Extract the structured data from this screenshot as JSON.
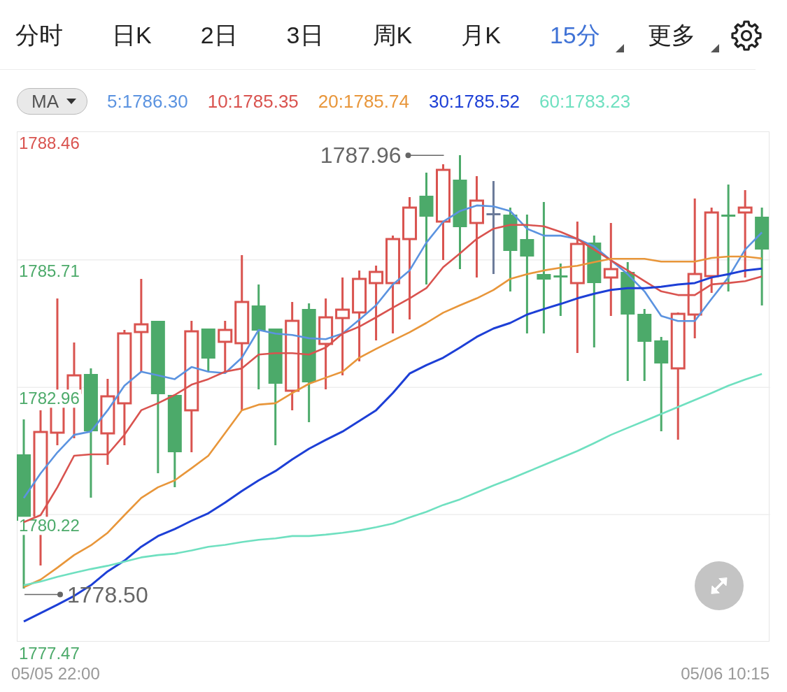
{
  "tabs": [
    {
      "label": "分时",
      "selected": false,
      "kind": "plain"
    },
    {
      "label": "日K",
      "selected": false,
      "kind": "plain"
    },
    {
      "label": "2日",
      "selected": false,
      "kind": "plain"
    },
    {
      "label": "3日",
      "selected": false,
      "kind": "plain"
    },
    {
      "label": "周K",
      "selected": false,
      "kind": "plain"
    },
    {
      "label": "月K",
      "selected": false,
      "kind": "plain"
    },
    {
      "label": "15分",
      "selected": true,
      "kind": "dropdown"
    },
    {
      "label": "更多",
      "selected": false,
      "kind": "dropdown"
    }
  ],
  "indicator": {
    "label": "MA",
    "readings": [
      {
        "text": "5:1786.30",
        "color": "#5b93e0"
      },
      {
        "text": "10:1785.35",
        "color": "#d9534f"
      },
      {
        "text": "20:1785.74",
        "color": "#e8963a"
      },
      {
        "text": "30:1785.52",
        "color": "#1d3fd6"
      },
      {
        "text": "60:1783.23",
        "color": "#6fe0c0"
      }
    ]
  },
  "chart": {
    "chart_data": {
      "type": "line",
      "grid": true,
      "ylim": [
        1777.47,
        1788.46
      ],
      "yticks": [
        {
          "value": 1788.46,
          "label": "1788.46"
        },
        {
          "value": 1785.71,
          "label": "1785.71"
        },
        {
          "value": 1782.96,
          "label": "1782.96"
        },
        {
          "value": 1780.22,
          "label": "1780.22"
        },
        {
          "value": 1777.47,
          "label": "1777.47"
        }
      ],
      "series": [
        {
          "color": "#5b93e0",
          "values": [
            1780.58,
            1781.11,
            1781.56,
            1781.94,
            1782.01,
            1782.47,
            1783.0,
            1783.3,
            1783.22,
            1783.14,
            1783.4,
            1783.3,
            1783.27,
            1783.6,
            1784.2,
            1784.12,
            1784.09,
            1784.02,
            1784.0,
            1784.12,
            1784.42,
            1784.73,
            1785.18,
            1785.48,
            1786.08,
            1786.53,
            1786.76,
            1786.88,
            1786.86,
            1786.76,
            1786.38,
            1786.23,
            1786.23,
            1786.16,
            1786.0,
            1785.7,
            1785.4,
            1785.03,
            1784.5,
            1784.39,
            1784.39,
            1784.87,
            1785.33,
            1785.93,
            1786.3
          ]
        },
        {
          "color": "#d9534f",
          "values": [
            1780.06,
            1780.21,
            1780.81,
            1781.49,
            1781.52,
            1781.52,
            1781.94,
            1782.47,
            1782.62,
            1782.8,
            1783.02,
            1783.14,
            1783.3,
            1783.37,
            1783.67,
            1783.7,
            1783.7,
            1783.67,
            1783.82,
            1784.12,
            1784.27,
            1784.47,
            1784.68,
            1784.88,
            1785.1,
            1785.55,
            1785.85,
            1786.16,
            1786.38,
            1786.46,
            1786.46,
            1786.43,
            1786.31,
            1786.16,
            1785.93,
            1785.7,
            1785.48,
            1785.25,
            1785.03,
            1784.95,
            1784.95,
            1785.18,
            1785.21,
            1785.25,
            1785.35
          ]
        },
        {
          "color": "#e8963a",
          "values": [
            1778.66,
            1778.82,
            1779.08,
            1779.35,
            1779.56,
            1779.83,
            1780.21,
            1780.58,
            1780.81,
            1780.96,
            1781.22,
            1781.49,
            1781.98,
            1782.47,
            1782.59,
            1782.62,
            1782.84,
            1783.04,
            1783.17,
            1783.3,
            1783.6,
            1783.79,
            1783.97,
            1784.15,
            1784.35,
            1784.57,
            1784.73,
            1784.88,
            1785.06,
            1785.3,
            1785.4,
            1785.48,
            1785.54,
            1785.58,
            1785.66,
            1785.73,
            1785.73,
            1785.73,
            1785.67,
            1785.67,
            1785.67,
            1785.75,
            1785.78,
            1785.78,
            1785.74
          ]
        },
        {
          "color": "#1d3fd6",
          "values": [
            1777.92,
            1778.1,
            1778.28,
            1778.47,
            1778.7,
            1779.0,
            1779.23,
            1779.53,
            1779.76,
            1779.91,
            1780.09,
            1780.25,
            1780.48,
            1780.73,
            1780.96,
            1781.16,
            1781.41,
            1781.64,
            1781.83,
            1782.01,
            1782.24,
            1782.47,
            1782.84,
            1783.26,
            1783.44,
            1783.6,
            1783.82,
            1784.05,
            1784.23,
            1784.35,
            1784.53,
            1784.65,
            1784.76,
            1784.88,
            1784.98,
            1785.06,
            1785.1,
            1785.1,
            1785.13,
            1785.18,
            1785.21,
            1785.33,
            1785.4,
            1785.48,
            1785.52
          ]
        },
        {
          "color": "#6fe0c0",
          "values": [
            1778.7,
            1778.78,
            1778.88,
            1778.97,
            1779.05,
            1779.12,
            1779.21,
            1779.3,
            1779.35,
            1779.38,
            1779.45,
            1779.53,
            1779.57,
            1779.63,
            1779.68,
            1779.71,
            1779.76,
            1779.76,
            1779.79,
            1779.83,
            1779.88,
            1779.95,
            1780.03,
            1780.16,
            1780.28,
            1780.43,
            1780.55,
            1780.7,
            1780.85,
            1780.99,
            1781.14,
            1781.29,
            1781.44,
            1781.59,
            1781.76,
            1781.94,
            1782.09,
            1782.24,
            1782.39,
            1782.54,
            1782.69,
            1782.84,
            1783.0,
            1783.13,
            1783.25
          ]
        }
      ],
      "annotations": [
        "1787.96",
        "1778.50"
      ]
    },
    "time_labels": [
      "05/05 22:00",
      "05/06 10:15"
    ]
  }
}
